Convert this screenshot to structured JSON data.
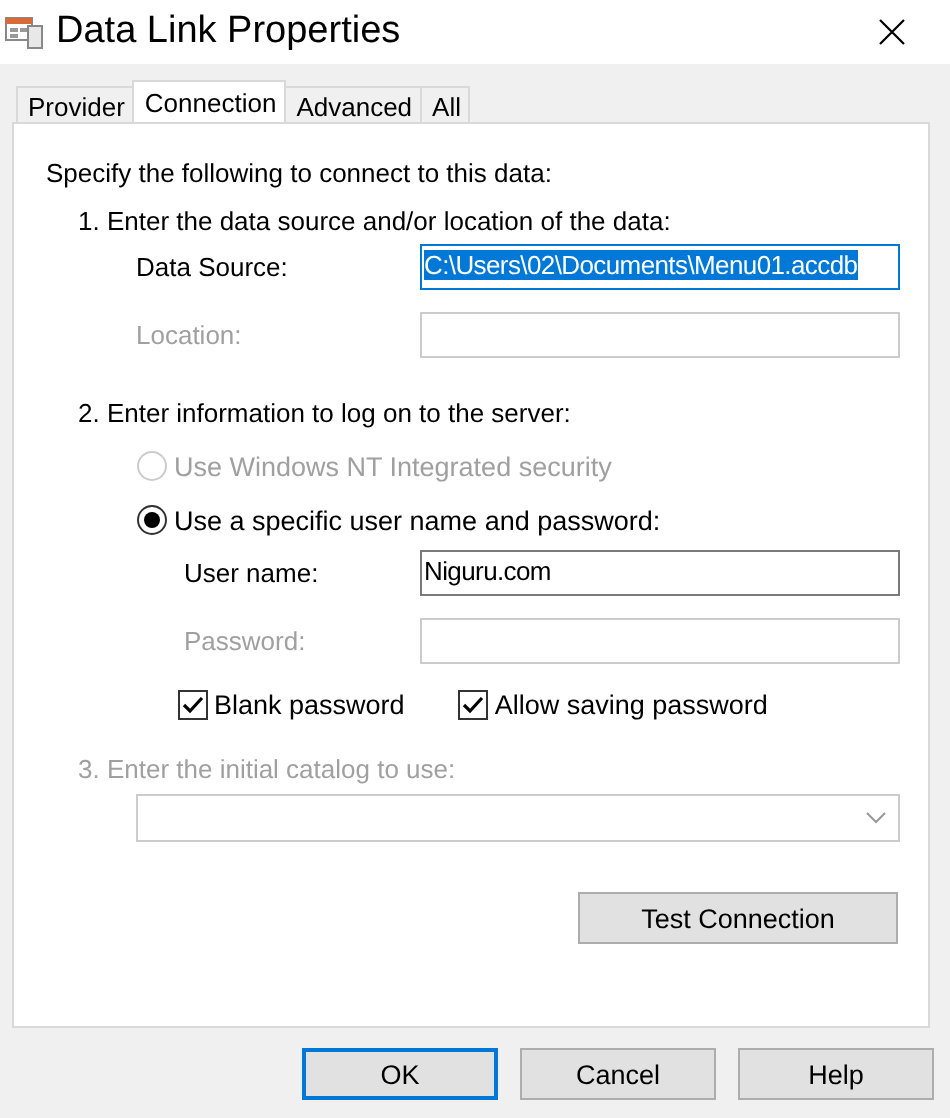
{
  "window": {
    "title": "Data Link Properties"
  },
  "tabs": [
    {
      "label": "Provider",
      "selected": false
    },
    {
      "label": "Connection",
      "selected": true
    },
    {
      "label": "Advanced",
      "selected": false
    },
    {
      "label": "All",
      "selected": false
    }
  ],
  "intro": "Specify the following to connect to this data:",
  "step1": {
    "label": "1. Enter the data source and/or location of the data:",
    "fields": [
      {
        "label": "Data Source:",
        "value": "C:\\Users\\02\\Documents\\Menu01.accdb",
        "disabled": false,
        "highlighted": true
      },
      {
        "label": "Location:",
        "disabled": true,
        "highlighted": false
      }
    ]
  },
  "step2": {
    "label": "2. Enter information to log on to the server:",
    "options": [
      {
        "label": "Use Windows NT Integrated security",
        "selected": false,
        "disabled": true
      },
      {
        "label": "Use a specific user name and password:",
        "selected": true,
        "disabled": false
      }
    ],
    "fields": [
      {
        "label": "User name:",
        "value": "Niguru.com",
        "disabled": false,
        "highlighted": false
      },
      {
        "label": "Password:",
        "disabled": true,
        "highlighted": false
      }
    ],
    "checkboxes": [
      {
        "label": "Blank password",
        "checked": true
      },
      {
        "label": "Allow saving password",
        "checked": true
      }
    ]
  },
  "step3": {
    "label": "3. Enter the initial catalog to use:",
    "disabled": true
  },
  "test_button": "Test Connection",
  "buttons": [
    {
      "label": "OK",
      "default": true
    },
    {
      "label": "Cancel",
      "default": false
    },
    {
      "label": "Help",
      "default": false
    }
  ]
}
